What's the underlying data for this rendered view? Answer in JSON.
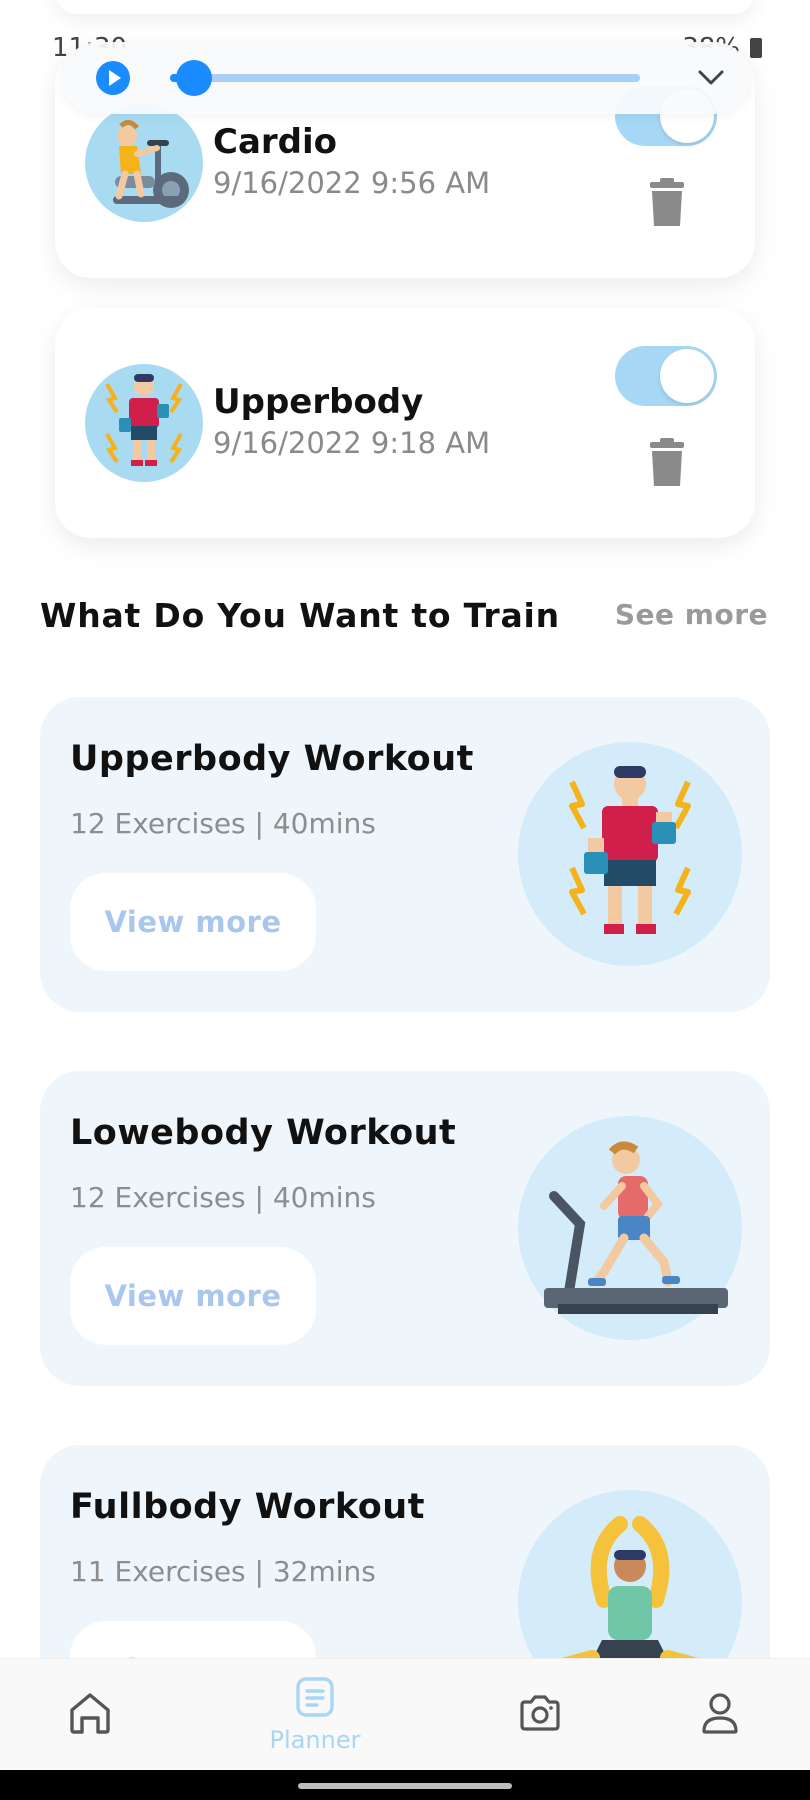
{
  "status_bar": {
    "time": "11:30",
    "battery": "38%"
  },
  "media_player": {
    "progress": 0.05
  },
  "recent_workouts": [
    {
      "name": "Cardio",
      "date": "9/16/2022 9:56 AM",
      "enabled": true,
      "icon": "exercise-bike-icon"
    },
    {
      "name": "Upperbody",
      "date": "9/16/2022 9:18 AM",
      "enabled": true,
      "icon": "dumbbell-man-icon"
    }
  ],
  "train_section": {
    "title": "What Do You Want to Train",
    "see_more": "See more"
  },
  "workouts": [
    {
      "title": "Upperbody Workout",
      "subtitle": "12 Exercises | 40mins",
      "button": "View more",
      "icon": "dumbbell-man-icon"
    },
    {
      "title": "Lowebody Workout",
      "subtitle": "12 Exercises | 40mins",
      "button": "View more",
      "icon": "treadmill-runner-icon"
    },
    {
      "title": "Fullbody Workout",
      "subtitle": "11 Exercises | 32mins",
      "button": "View more",
      "icon": "yoga-stretch-icon"
    }
  ],
  "bottom_nav": {
    "items": [
      {
        "id": "home",
        "label": "",
        "icon": "home-icon"
      },
      {
        "id": "planner",
        "label": "Planner",
        "icon": "planner-icon",
        "active": true
      },
      {
        "id": "camera",
        "label": "",
        "icon": "camera-icon"
      },
      {
        "id": "profile",
        "label": "",
        "icon": "profile-icon"
      }
    ]
  },
  "colors": {
    "accent": "#1a8cff",
    "toggle_on": "#a6d8f5",
    "card_bg": "#eef6fc",
    "active_nav": "#a8d6f3"
  }
}
